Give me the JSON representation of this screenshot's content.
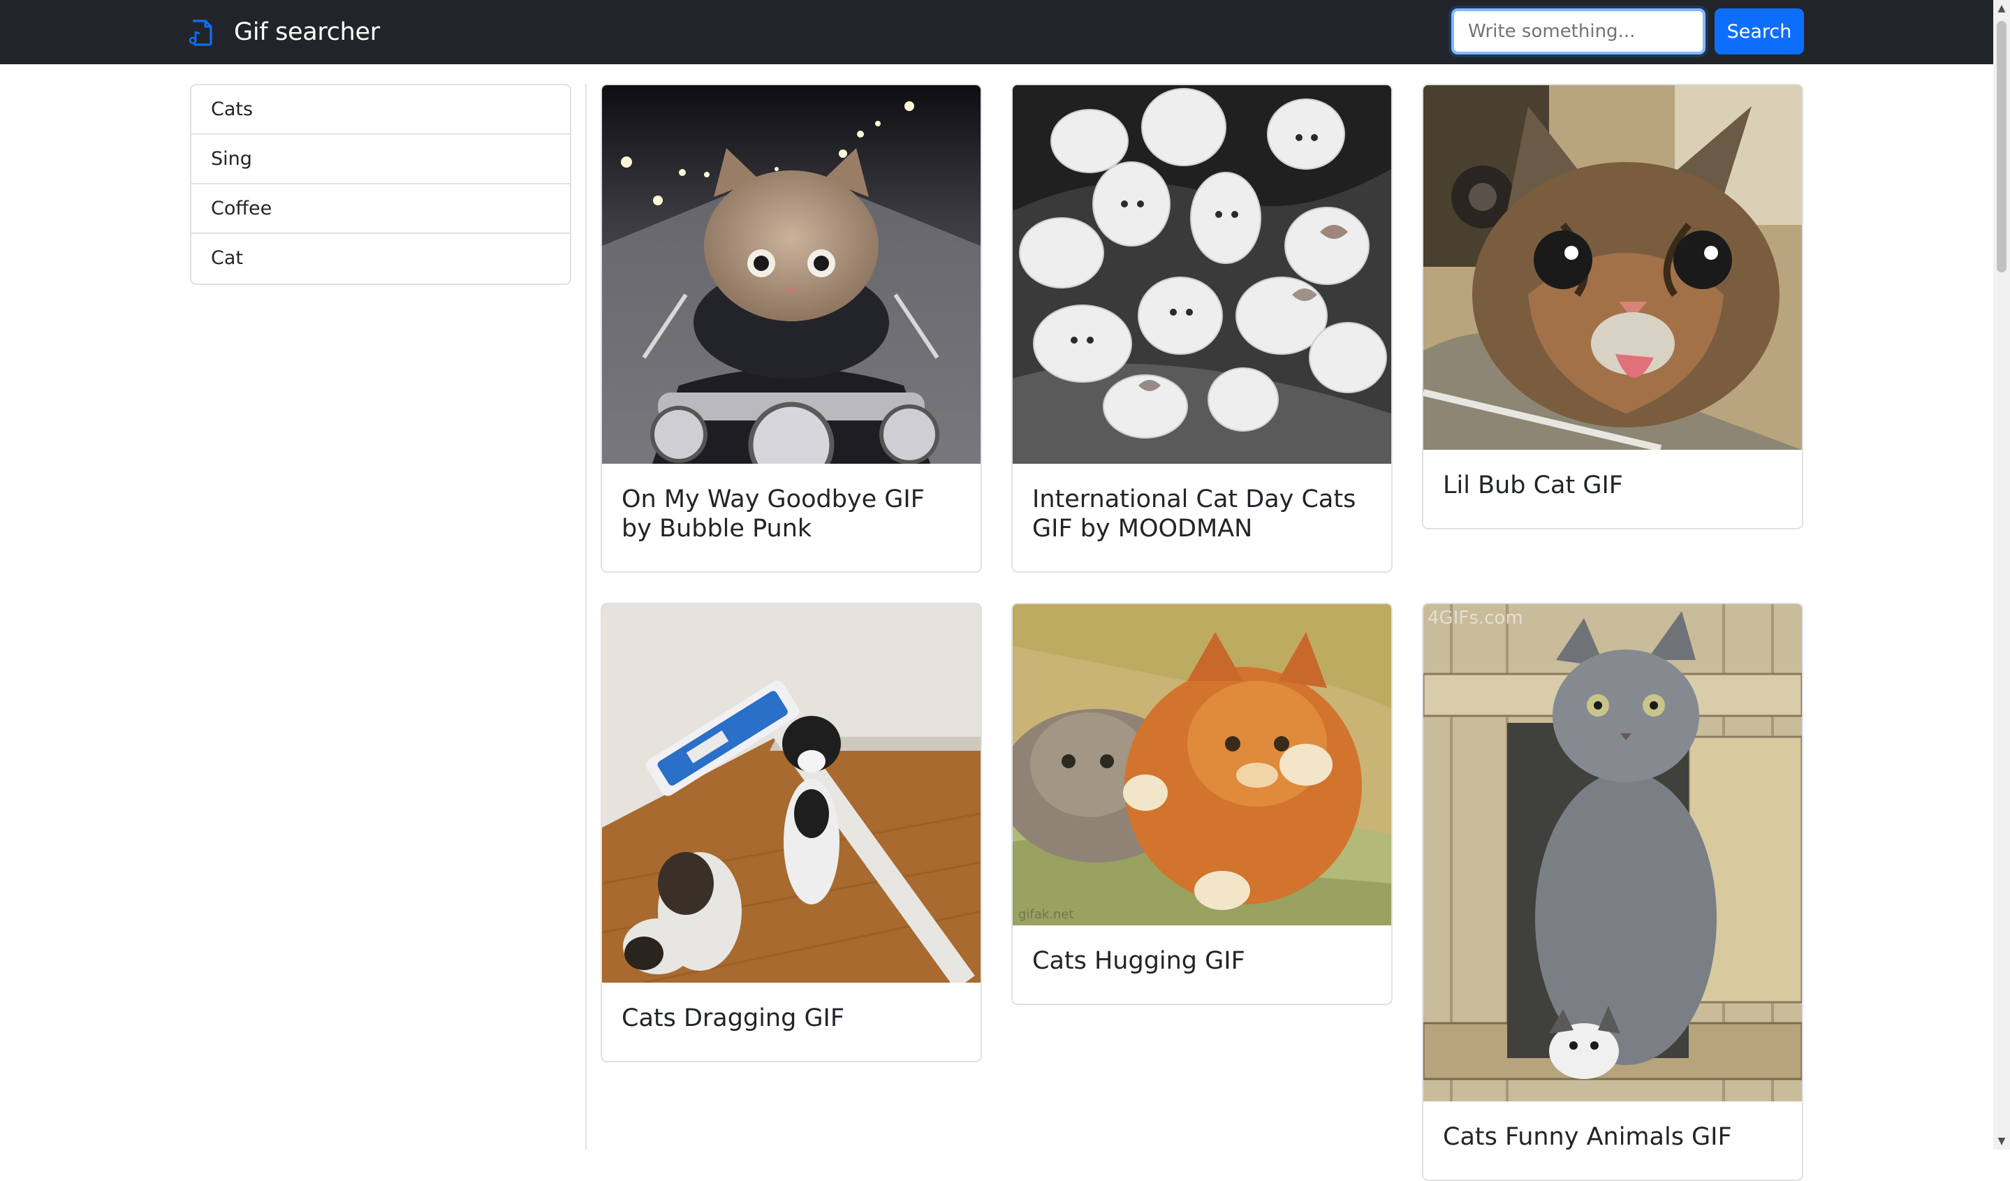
{
  "header": {
    "title": "Gif searcher",
    "brand_icon": "music-note-file-icon",
    "search_placeholder": "Write something...",
    "search_value": "",
    "search_button": "Search"
  },
  "sidebar": {
    "items": [
      {
        "label": "Cats"
      },
      {
        "label": "Sing"
      },
      {
        "label": "Coffee"
      },
      {
        "label": "Cat"
      }
    ]
  },
  "gifs": [
    {
      "title": "On My Way Goodbye GIF by Bubble Punk",
      "image_alt": "kitten riding a motorcycle at night"
    },
    {
      "title": "International Cat Day Cats GIF by MOODMAN",
      "image_alt": "many white kittens"
    },
    {
      "title": "Lil Bub Cat GIF",
      "image_alt": "tabby cat with tongue out"
    },
    {
      "title": "Cats Dragging GIF",
      "image_alt": "kittens holding a floor mop"
    },
    {
      "title": "Cats Hugging GIF",
      "image_alt": "orange cat hugging a grey cat",
      "watermark": "gifak.net"
    },
    {
      "title": "Cats Funny Animals GIF",
      "image_alt": "grey cat in a wooden box with kitten",
      "watermark": "4GIFs.com"
    }
  ],
  "colors": {
    "navbar": "#212529",
    "accent": "#0d6efd",
    "border": "#dee2e6"
  }
}
